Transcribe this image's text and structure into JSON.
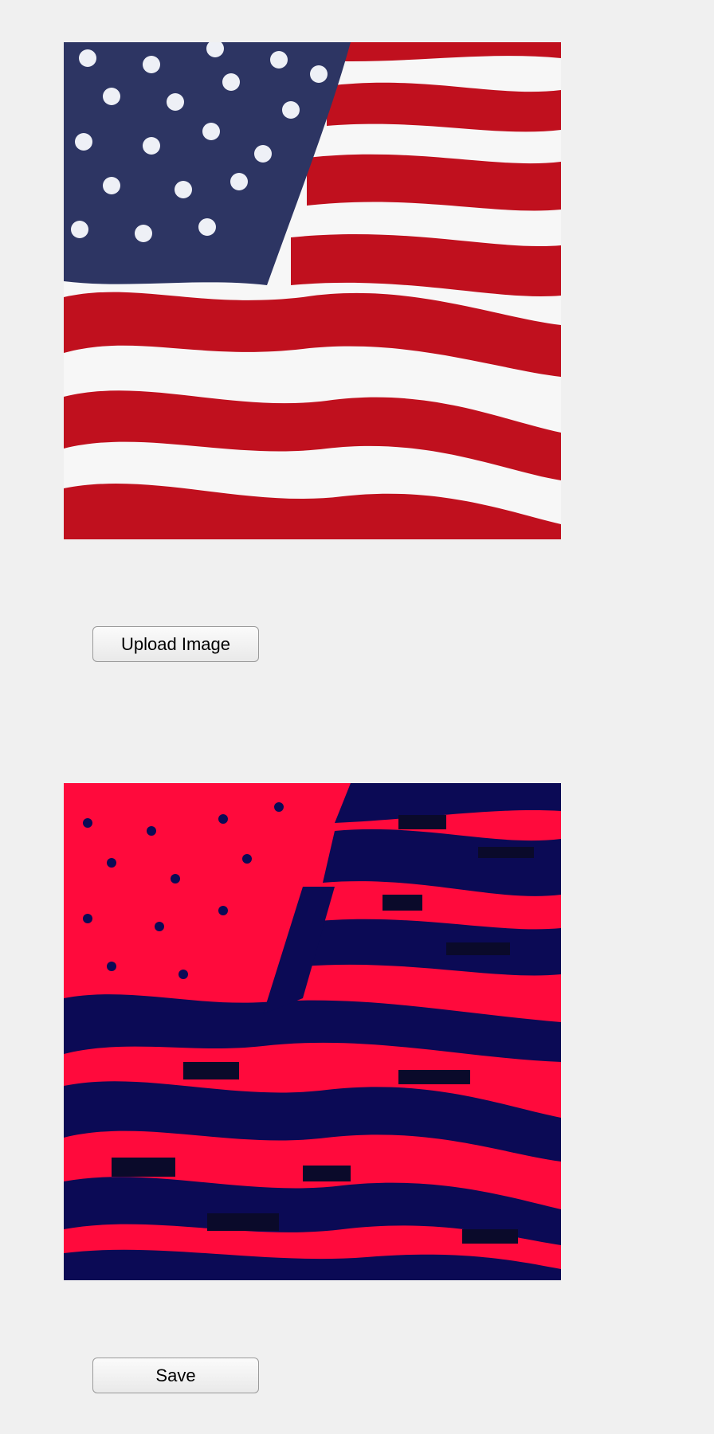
{
  "original_image": {
    "icon": "us-flag-photo",
    "colors": {
      "blue": "#2d3563",
      "red": "#c0101e",
      "white": "#f7f7f7",
      "star": "#eef0f6"
    }
  },
  "processed_image": {
    "icon": "posterized-flag-output",
    "colors": {
      "red": "#ff0a3c",
      "navy": "#0b0a55",
      "dark": "#0a0a2a"
    }
  },
  "buttons": {
    "upload_label": "Upload Image",
    "save_label": "Save"
  }
}
